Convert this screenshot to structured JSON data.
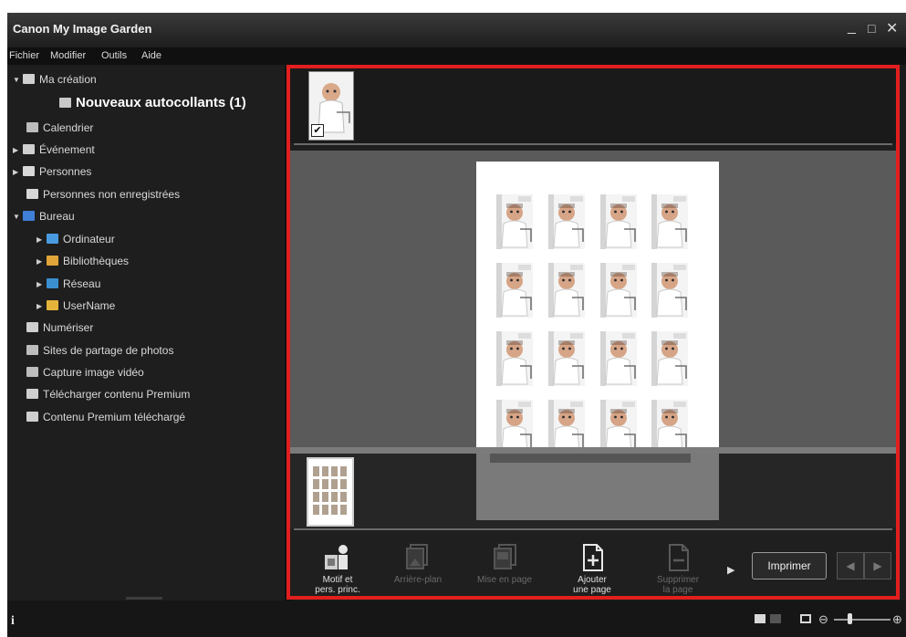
{
  "window": {
    "title": "Canon My Image Garden",
    "controls": {
      "minimize": "_",
      "maximize": "□",
      "close": "✕"
    }
  },
  "menu": [
    "Fichier",
    "Modifier",
    "Outils",
    "Aide"
  ],
  "sidebar": {
    "items": [
      {
        "label": "Ma création",
        "arrow": "▼",
        "icon": "my-creation-icon"
      },
      {
        "label": "Nouveaux autocollants (1)",
        "arrow": "",
        "icon": "stickers-icon"
      },
      {
        "label": "Calendrier",
        "arrow": "",
        "icon": "calendar-icon"
      },
      {
        "label": "Événement",
        "arrow": "▶",
        "icon": "event-icon"
      },
      {
        "label": "Personnes",
        "arrow": "▶",
        "icon": "people-icon"
      },
      {
        "label": "Personnes non enregistrées",
        "arrow": "",
        "icon": "unregistered-people-icon"
      },
      {
        "label": "Bureau",
        "arrow": "▼",
        "icon": "desktop-icon"
      },
      {
        "label": "Ordinateur",
        "arrow": "▶",
        "icon": "computer-icon"
      },
      {
        "label": "Bibliothèques",
        "arrow": "▶",
        "icon": "libraries-icon"
      },
      {
        "label": "Réseau",
        "arrow": "▶",
        "icon": "network-icon"
      },
      {
        "label": "UserName",
        "arrow": "▶",
        "icon": "user-folder-icon"
      },
      {
        "label": "Numériser",
        "arrow": "",
        "icon": "scan-icon"
      },
      {
        "label": "Sites de partage de photos",
        "arrow": "",
        "icon": "photo-sharing-icon"
      },
      {
        "label": "Capture image vidéo",
        "arrow": "",
        "icon": "video-capture-icon"
      },
      {
        "label": "Télécharger contenu Premium",
        "arrow": "",
        "icon": "download-premium-icon"
      },
      {
        "label": "Contenu Premium téléchargé",
        "arrow": "",
        "icon": "premium-folder-icon"
      }
    ]
  },
  "toolbar": {
    "buttons": [
      {
        "line1": "Motif et",
        "line2": "pers. princ.",
        "enabled": true,
        "icon": "theme-person-icon"
      },
      {
        "line1": "Arrière-plan",
        "line2": "",
        "enabled": false,
        "icon": "background-icon"
      },
      {
        "line1": "Mise en page",
        "line2": "",
        "enabled": false,
        "icon": "layout-icon"
      },
      {
        "line1": "Ajouter",
        "line2": "une page",
        "enabled": true,
        "icon": "add-page-icon"
      },
      {
        "line1": "Supprimer",
        "line2": "la page",
        "enabled": false,
        "icon": "delete-page-icon"
      }
    ],
    "more": "▶",
    "print_label": "Imprimer",
    "prev": "◀",
    "next": "▶"
  },
  "statusbar": {
    "info": "i",
    "zoom_minus": "⊖",
    "zoom_plus": "⊕",
    "zoom_level": 0.25
  },
  "colors": {
    "highlight_frame": "#e31e1e",
    "background": "#1b1b1b"
  }
}
